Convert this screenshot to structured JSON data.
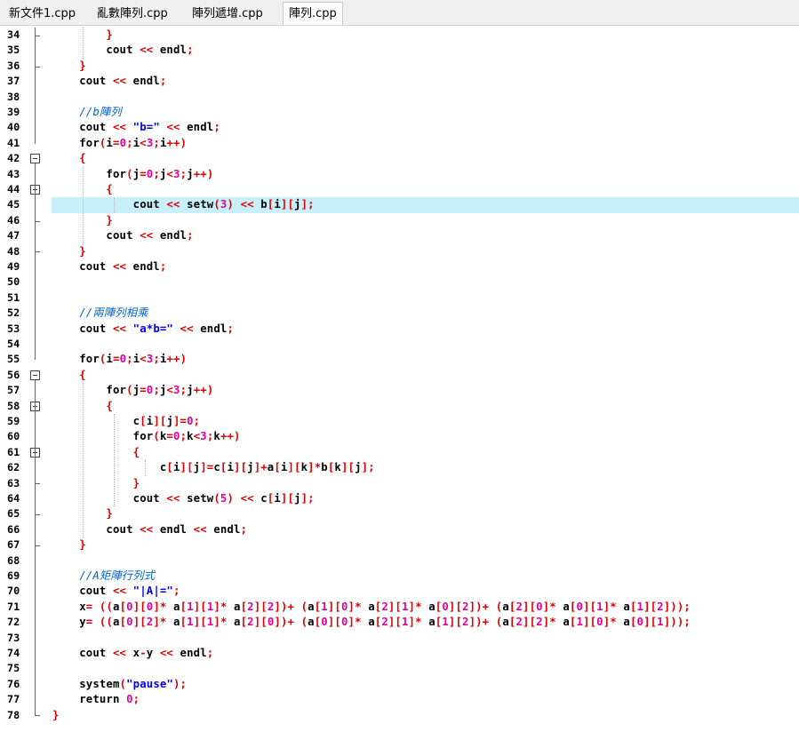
{
  "tabs": [
    {
      "label": "新文件1.cpp",
      "active": false
    },
    {
      "label": "亂數陣列.cpp",
      "active": false
    },
    {
      "label": "陣列遞增.cpp",
      "active": false
    },
    {
      "label": "陣列.cpp",
      "active": true
    }
  ],
  "highlighted_line": 45,
  "code_lines": [
    {
      "n": "34",
      "tokens": [
        [
          "p",
          "        }"
        ]
      ]
    },
    {
      "n": "35",
      "tokens": [
        [
          "k",
          "        cout "
        ],
        [
          "p",
          "<<"
        ],
        [
          "k",
          " endl"
        ],
        [
          "p",
          ";"
        ]
      ]
    },
    {
      "n": "36",
      "tokens": [
        [
          "p",
          "    }"
        ]
      ]
    },
    {
      "n": "37",
      "tokens": [
        [
          "k",
          "    cout "
        ],
        [
          "p",
          "<<"
        ],
        [
          "k",
          " endl"
        ],
        [
          "p",
          ";"
        ]
      ]
    },
    {
      "n": "38",
      "tokens": []
    },
    {
      "n": "39",
      "tokens": [
        [
          "c",
          "    //b陣列"
        ]
      ]
    },
    {
      "n": "40",
      "tokens": [
        [
          "k",
          "    cout "
        ],
        [
          "p",
          "<<"
        ],
        [
          "k",
          " "
        ],
        [
          "s",
          "\"b=\""
        ],
        [
          "k",
          " "
        ],
        [
          "p",
          "<<"
        ],
        [
          "k",
          " endl"
        ],
        [
          "p",
          ";"
        ]
      ]
    },
    {
      "n": "41",
      "tokens": [
        [
          "k",
          "    for"
        ],
        [
          "p",
          "("
        ],
        [
          "k",
          "i"
        ],
        [
          "p",
          "="
        ],
        [
          "n",
          "0"
        ],
        [
          "p",
          ";"
        ],
        [
          "k",
          "i"
        ],
        [
          "p",
          "<"
        ],
        [
          "n",
          "3"
        ],
        [
          "p",
          ";"
        ],
        [
          "k",
          "i"
        ],
        [
          "p",
          "++)"
        ]
      ]
    },
    {
      "n": "42",
      "tokens": [
        [
          "p",
          "    {"
        ]
      ]
    },
    {
      "n": "43",
      "tokens": [
        [
          "k",
          "        for"
        ],
        [
          "p",
          "("
        ],
        [
          "k",
          "j"
        ],
        [
          "p",
          "="
        ],
        [
          "n",
          "0"
        ],
        [
          "p",
          ";"
        ],
        [
          "k",
          "j"
        ],
        [
          "p",
          "<"
        ],
        [
          "n",
          "3"
        ],
        [
          "p",
          ";"
        ],
        [
          "k",
          "j"
        ],
        [
          "p",
          "++)"
        ]
      ]
    },
    {
      "n": "44",
      "tokens": [
        [
          "p",
          "        {"
        ]
      ]
    },
    {
      "n": "45",
      "tokens": [
        [
          "k",
          "            cout "
        ],
        [
          "p",
          "<<"
        ],
        [
          "k",
          " setw"
        ],
        [
          "p",
          "("
        ],
        [
          "n",
          "3"
        ],
        [
          "p",
          ")"
        ],
        [
          "k",
          " "
        ],
        [
          "p",
          "<<"
        ],
        [
          "k",
          " b"
        ],
        [
          "p",
          "["
        ],
        [
          "k",
          "i"
        ],
        [
          "p",
          "]["
        ],
        [
          "k",
          "j"
        ],
        [
          "p",
          "];"
        ]
      ]
    },
    {
      "n": "46",
      "tokens": [
        [
          "p",
          "        }"
        ]
      ]
    },
    {
      "n": "47",
      "tokens": [
        [
          "k",
          "        cout "
        ],
        [
          "p",
          "<<"
        ],
        [
          "k",
          " endl"
        ],
        [
          "p",
          ";"
        ]
      ]
    },
    {
      "n": "48",
      "tokens": [
        [
          "p",
          "    }"
        ]
      ]
    },
    {
      "n": "49",
      "tokens": [
        [
          "k",
          "    cout "
        ],
        [
          "p",
          "<<"
        ],
        [
          "k",
          " endl"
        ],
        [
          "p",
          ";"
        ]
      ]
    },
    {
      "n": "50",
      "tokens": []
    },
    {
      "n": "51",
      "tokens": []
    },
    {
      "n": "52",
      "tokens": [
        [
          "c",
          "    //兩陣列相乘"
        ]
      ]
    },
    {
      "n": "53",
      "tokens": [
        [
          "k",
          "    cout "
        ],
        [
          "p",
          "<<"
        ],
        [
          "k",
          " "
        ],
        [
          "s",
          "\"a*b=\""
        ],
        [
          "k",
          " "
        ],
        [
          "p",
          "<<"
        ],
        [
          "k",
          " endl"
        ],
        [
          "p",
          ";"
        ]
      ]
    },
    {
      "n": "54",
      "tokens": []
    },
    {
      "n": "55",
      "tokens": [
        [
          "k",
          "    for"
        ],
        [
          "p",
          "("
        ],
        [
          "k",
          "i"
        ],
        [
          "p",
          "="
        ],
        [
          "n",
          "0"
        ],
        [
          "p",
          ";"
        ],
        [
          "k",
          "i"
        ],
        [
          "p",
          "<"
        ],
        [
          "n",
          "3"
        ],
        [
          "p",
          ";"
        ],
        [
          "k",
          "i"
        ],
        [
          "p",
          "++)"
        ]
      ]
    },
    {
      "n": "56",
      "tokens": [
        [
          "p",
          "    {"
        ]
      ]
    },
    {
      "n": "57",
      "tokens": [
        [
          "k",
          "        for"
        ],
        [
          "p",
          "("
        ],
        [
          "k",
          "j"
        ],
        [
          "p",
          "="
        ],
        [
          "n",
          "0"
        ],
        [
          "p",
          ";"
        ],
        [
          "k",
          "j"
        ],
        [
          "p",
          "<"
        ],
        [
          "n",
          "3"
        ],
        [
          "p",
          ";"
        ],
        [
          "k",
          "j"
        ],
        [
          "p",
          "++)"
        ]
      ]
    },
    {
      "n": "58",
      "tokens": [
        [
          "p",
          "        {"
        ]
      ]
    },
    {
      "n": "59",
      "tokens": [
        [
          "k",
          "            c"
        ],
        [
          "p",
          "["
        ],
        [
          "k",
          "i"
        ],
        [
          "p",
          "]["
        ],
        [
          "k",
          "j"
        ],
        [
          "p",
          "]="
        ],
        [
          "n",
          "0"
        ],
        [
          "p",
          ";"
        ]
      ]
    },
    {
      "n": "60",
      "tokens": [
        [
          "k",
          "            for"
        ],
        [
          "p",
          "("
        ],
        [
          "k",
          "k"
        ],
        [
          "p",
          "="
        ],
        [
          "n",
          "0"
        ],
        [
          "p",
          ";"
        ],
        [
          "k",
          "k"
        ],
        [
          "p",
          "<"
        ],
        [
          "n",
          "3"
        ],
        [
          "p",
          ";"
        ],
        [
          "k",
          "k"
        ],
        [
          "p",
          "++)"
        ]
      ]
    },
    {
      "n": "61",
      "tokens": [
        [
          "p",
          "            {"
        ]
      ]
    },
    {
      "n": "62",
      "tokens": [
        [
          "k",
          "                c"
        ],
        [
          "p",
          "["
        ],
        [
          "k",
          "i"
        ],
        [
          "p",
          "]["
        ],
        [
          "k",
          "j"
        ],
        [
          "p",
          "]="
        ],
        [
          "k",
          "c"
        ],
        [
          "p",
          "["
        ],
        [
          "k",
          "i"
        ],
        [
          "p",
          "]["
        ],
        [
          "k",
          "j"
        ],
        [
          "p",
          "]+"
        ],
        [
          "k",
          "a"
        ],
        [
          "p",
          "["
        ],
        [
          "k",
          "i"
        ],
        [
          "p",
          "]["
        ],
        [
          "k",
          "k"
        ],
        [
          "p",
          "]*"
        ],
        [
          "k",
          "b"
        ],
        [
          "p",
          "["
        ],
        [
          "k",
          "k"
        ],
        [
          "p",
          "]["
        ],
        [
          "k",
          "j"
        ],
        [
          "p",
          "];"
        ]
      ]
    },
    {
      "n": "63",
      "tokens": [
        [
          "p",
          "            }"
        ]
      ]
    },
    {
      "n": "64",
      "tokens": [
        [
          "k",
          "            cout "
        ],
        [
          "p",
          "<<"
        ],
        [
          "k",
          " setw"
        ],
        [
          "p",
          "("
        ],
        [
          "n",
          "5"
        ],
        [
          "p",
          ")"
        ],
        [
          "k",
          " "
        ],
        [
          "p",
          "<<"
        ],
        [
          "k",
          " c"
        ],
        [
          "p",
          "["
        ],
        [
          "k",
          "i"
        ],
        [
          "p",
          "]["
        ],
        [
          "k",
          "j"
        ],
        [
          "p",
          "];"
        ]
      ]
    },
    {
      "n": "65",
      "tokens": [
        [
          "p",
          "        }"
        ]
      ]
    },
    {
      "n": "66",
      "tokens": [
        [
          "k",
          "        cout "
        ],
        [
          "p",
          "<<"
        ],
        [
          "k",
          " endl "
        ],
        [
          "p",
          "<<"
        ],
        [
          "k",
          " endl"
        ],
        [
          "p",
          ";"
        ]
      ]
    },
    {
      "n": "67",
      "tokens": [
        [
          "p",
          "    }"
        ]
      ]
    },
    {
      "n": "68",
      "tokens": []
    },
    {
      "n": "69",
      "tokens": [
        [
          "c",
          "    //A矩陣行列式"
        ]
      ]
    },
    {
      "n": "70",
      "tokens": [
        [
          "k",
          "    cout "
        ],
        [
          "p",
          "<<"
        ],
        [
          "k",
          " "
        ],
        [
          "s",
          "\"|A|=\""
        ],
        [
          "p",
          ";"
        ]
      ]
    },
    {
      "n": "71",
      "tokens": [
        [
          "k",
          "    x"
        ],
        [
          "p",
          "= (("
        ],
        [
          "k",
          "a"
        ],
        [
          "p",
          "["
        ],
        [
          "n",
          "0"
        ],
        [
          "p",
          "]["
        ],
        [
          "n",
          "0"
        ],
        [
          "p",
          "]*"
        ],
        [
          "k",
          " a"
        ],
        [
          "p",
          "["
        ],
        [
          "n",
          "1"
        ],
        [
          "p",
          "]["
        ],
        [
          "n",
          "1"
        ],
        [
          "p",
          "]*"
        ],
        [
          "k",
          " a"
        ],
        [
          "p",
          "["
        ],
        [
          "n",
          "2"
        ],
        [
          "p",
          "]["
        ],
        [
          "n",
          "2"
        ],
        [
          "p",
          "])+ ("
        ],
        [
          "k",
          "a"
        ],
        [
          "p",
          "["
        ],
        [
          "n",
          "1"
        ],
        [
          "p",
          "]["
        ],
        [
          "n",
          "0"
        ],
        [
          "p",
          "]*"
        ],
        [
          "k",
          " a"
        ],
        [
          "p",
          "["
        ],
        [
          "n",
          "2"
        ],
        [
          "p",
          "]["
        ],
        [
          "n",
          "1"
        ],
        [
          "p",
          "]*"
        ],
        [
          "k",
          " a"
        ],
        [
          "p",
          "["
        ],
        [
          "n",
          "0"
        ],
        [
          "p",
          "]["
        ],
        [
          "n",
          "2"
        ],
        [
          "p",
          "])+ ("
        ],
        [
          "k",
          "a"
        ],
        [
          "p",
          "["
        ],
        [
          "n",
          "2"
        ],
        [
          "p",
          "]["
        ],
        [
          "n",
          "0"
        ],
        [
          "p",
          "]*"
        ],
        [
          "k",
          " a"
        ],
        [
          "p",
          "["
        ],
        [
          "n",
          "0"
        ],
        [
          "p",
          "]["
        ],
        [
          "n",
          "1"
        ],
        [
          "p",
          "]*"
        ],
        [
          "k",
          " a"
        ],
        [
          "p",
          "["
        ],
        [
          "n",
          "1"
        ],
        [
          "p",
          "]["
        ],
        [
          "n",
          "2"
        ],
        [
          "p",
          "]));"
        ]
      ]
    },
    {
      "n": "72",
      "tokens": [
        [
          "k",
          "    y"
        ],
        [
          "p",
          "= (("
        ],
        [
          "k",
          "a"
        ],
        [
          "p",
          "["
        ],
        [
          "n",
          "0"
        ],
        [
          "p",
          "]["
        ],
        [
          "n",
          "2"
        ],
        [
          "p",
          "]*"
        ],
        [
          "k",
          " a"
        ],
        [
          "p",
          "["
        ],
        [
          "n",
          "1"
        ],
        [
          "p",
          "]["
        ],
        [
          "n",
          "1"
        ],
        [
          "p",
          "]*"
        ],
        [
          "k",
          " a"
        ],
        [
          "p",
          "["
        ],
        [
          "n",
          "2"
        ],
        [
          "p",
          "]["
        ],
        [
          "n",
          "0"
        ],
        [
          "p",
          "])+ ("
        ],
        [
          "k",
          "a"
        ],
        [
          "p",
          "["
        ],
        [
          "n",
          "0"
        ],
        [
          "p",
          "]["
        ],
        [
          "n",
          "0"
        ],
        [
          "p",
          "]*"
        ],
        [
          "k",
          " a"
        ],
        [
          "p",
          "["
        ],
        [
          "n",
          "2"
        ],
        [
          "p",
          "]["
        ],
        [
          "n",
          "1"
        ],
        [
          "p",
          "]*"
        ],
        [
          "k",
          " a"
        ],
        [
          "p",
          "["
        ],
        [
          "n",
          "1"
        ],
        [
          "p",
          "]["
        ],
        [
          "n",
          "2"
        ],
        [
          "p",
          "])+ ("
        ],
        [
          "k",
          "a"
        ],
        [
          "p",
          "["
        ],
        [
          "n",
          "2"
        ],
        [
          "p",
          "]["
        ],
        [
          "n",
          "2"
        ],
        [
          "p",
          "]*"
        ],
        [
          "k",
          " a"
        ],
        [
          "p",
          "["
        ],
        [
          "n",
          "1"
        ],
        [
          "p",
          "]["
        ],
        [
          "n",
          "0"
        ],
        [
          "p",
          "]*"
        ],
        [
          "k",
          " a"
        ],
        [
          "p",
          "["
        ],
        [
          "n",
          "0"
        ],
        [
          "p",
          "]["
        ],
        [
          "n",
          "1"
        ],
        [
          "p",
          "]));"
        ]
      ]
    },
    {
      "n": "73",
      "tokens": []
    },
    {
      "n": "74",
      "tokens": [
        [
          "k",
          "    cout "
        ],
        [
          "p",
          "<<"
        ],
        [
          "k",
          " x"
        ],
        [
          "p",
          "-"
        ],
        [
          "k",
          "y "
        ],
        [
          "p",
          "<<"
        ],
        [
          "k",
          " endl"
        ],
        [
          "p",
          ";"
        ]
      ]
    },
    {
      "n": "75",
      "tokens": []
    },
    {
      "n": "76",
      "tokens": [
        [
          "k",
          "    system"
        ],
        [
          "p",
          "("
        ],
        [
          "s",
          "\"pause\""
        ],
        [
          "p",
          ");"
        ]
      ]
    },
    {
      "n": "77",
      "tokens": [
        [
          "k",
          "    return "
        ],
        [
          "n",
          "0"
        ],
        [
          "p",
          ";"
        ]
      ]
    },
    {
      "n": "78",
      "tokens": [
        [
          "p",
          "}"
        ]
      ]
    }
  ]
}
